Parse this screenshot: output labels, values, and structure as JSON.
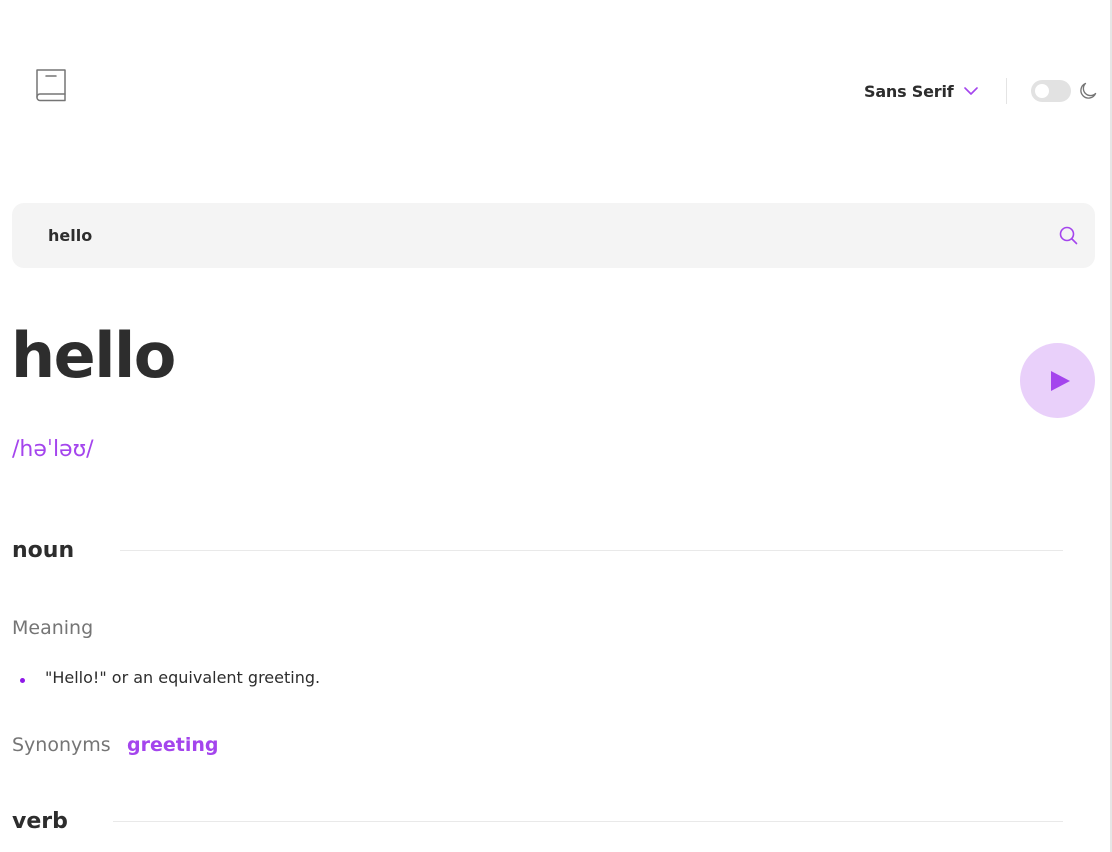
{
  "header": {
    "logo_icon": "book-icon",
    "font_selector": {
      "selected": "Sans Serif",
      "icon": "chevron-down-icon"
    },
    "theme_toggle": {
      "state": "off",
      "icon": "moon-icon"
    }
  },
  "search": {
    "value": "hello",
    "icon": "search-icon"
  },
  "entry": {
    "word": "hello",
    "phonetic": "/həˈləʊ/",
    "play_icon": "play-icon"
  },
  "meanings": [
    {
      "part_of_speech": "noun",
      "meaning_label": "Meaning",
      "definitions": [
        "\"Hello!\" or an equivalent greeting."
      ],
      "synonyms_label": "Synonyms",
      "synonyms": [
        "greeting"
      ]
    },
    {
      "part_of_speech": "verb"
    }
  ],
  "colors": {
    "accent": "#a445ed",
    "accent_light": "#e9d0fa",
    "text": "#2d2d2d",
    "muted": "#757575",
    "search_bg": "#f4f4f4",
    "divider": "#e9e9e9"
  }
}
